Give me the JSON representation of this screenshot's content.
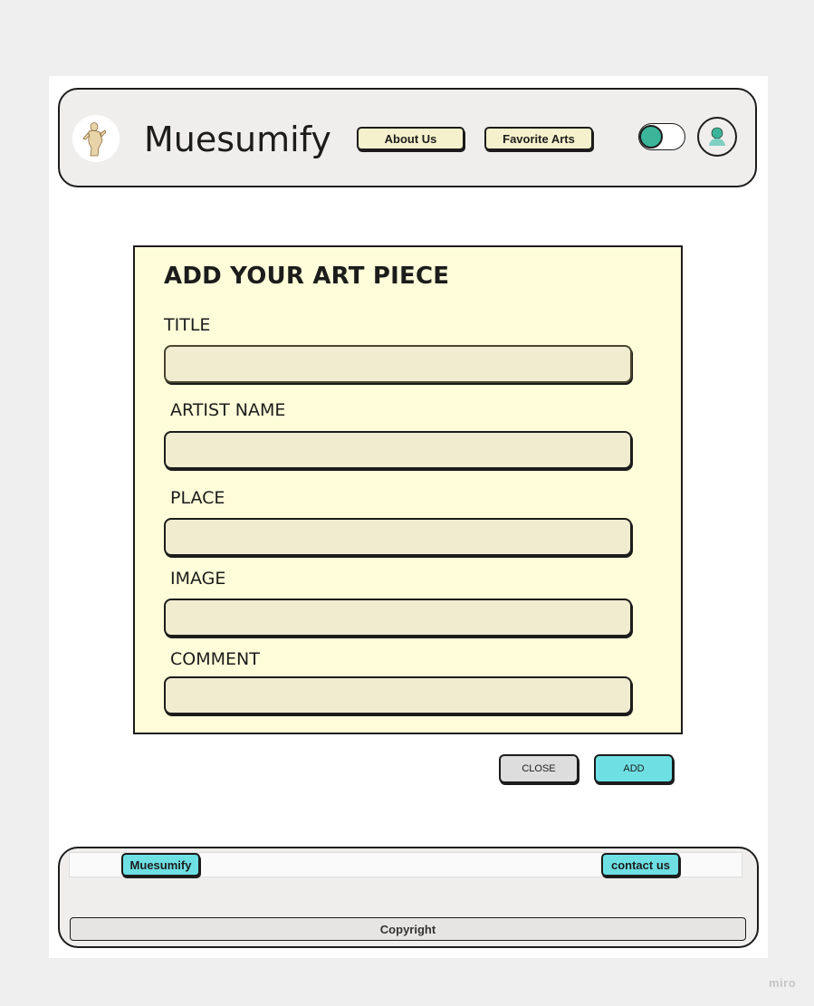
{
  "header": {
    "brand": "Muesumify",
    "nav": [
      "About Us",
      "Favorite Arts"
    ],
    "logo_icon": "statue-icon",
    "theme_toggle_icon": "toggle-icon",
    "avatar_icon": "user-avatar-icon"
  },
  "form": {
    "title": "ADD YOUR ART PIECE",
    "fields": [
      {
        "label": "TITLE",
        "value": "",
        "placeholder": ""
      },
      {
        "label": "ARTIST NAME",
        "value": "",
        "placeholder": ""
      },
      {
        "label": "PLACE",
        "value": "",
        "placeholder": ""
      },
      {
        "label": "IMAGE",
        "value": "",
        "placeholder": ""
      },
      {
        "label": "COMMENT",
        "value": "",
        "placeholder": ""
      }
    ],
    "close_label": "CLOSE",
    "add_label": "ADD"
  },
  "footer": {
    "brand_label": "Muesumify",
    "contact_label": "contact us",
    "copyright": "Copyright"
  },
  "watermark": "miro",
  "colors": {
    "accent_teal": "#6ee0e4",
    "toggle_green": "#3bb59a",
    "card_bg": "#fefcd9",
    "nav_btn_bg": "#f5f1cc",
    "close_btn_bg": "#dddddd"
  }
}
